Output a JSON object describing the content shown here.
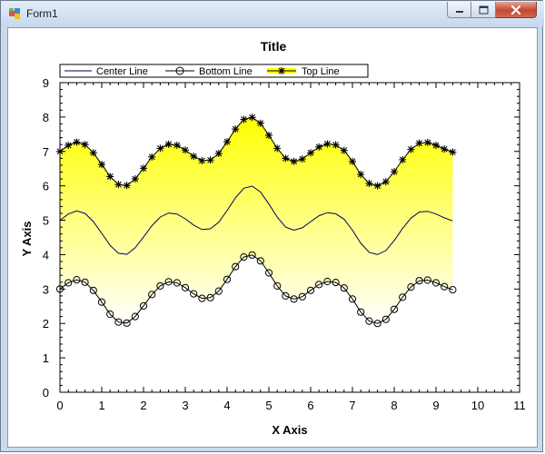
{
  "window": {
    "title": "Form1",
    "controls": {
      "minimize_icon": "minimize-icon",
      "maximize_icon": "maximize-icon",
      "close_icon": "close-icon"
    }
  },
  "colors": {
    "fill_top": "#ffff00",
    "fill_bottom": "#ffffff",
    "line": "#000066",
    "border": "#000000"
  },
  "chart_data": {
    "type": "area",
    "title": "Title",
    "xlabel": "X Axis",
    "ylabel": "Y Axis",
    "xlim": [
      0,
      11
    ],
    "ylim": [
      0,
      9
    ],
    "x_ticks": [
      "0",
      "1",
      "2",
      "3",
      "4",
      "5",
      "6",
      "7",
      "8",
      "9",
      "10",
      "11"
    ],
    "y_ticks": [
      "0",
      "1",
      "2",
      "3",
      "4",
      "5",
      "6",
      "7",
      "8",
      "9"
    ],
    "grid": false,
    "legend_position": "top",
    "legend": [
      "Center Line",
      "Bottom Line",
      "Top Line"
    ],
    "x": [
      0.0,
      0.2,
      0.4,
      0.6,
      0.8,
      1.0,
      1.2,
      1.4,
      1.6,
      1.8,
      2.0,
      2.2,
      2.4,
      2.6,
      2.8,
      3.0,
      3.2,
      3.4,
      3.6,
      3.8,
      4.0,
      4.2,
      4.4,
      4.6,
      4.8,
      5.0,
      5.2,
      5.4,
      5.6,
      5.8,
      6.0,
      6.2,
      6.4,
      6.6,
      6.8,
      7.0,
      7.2,
      7.4,
      7.6,
      7.8,
      8.0,
      8.2,
      8.4,
      8.6,
      8.8,
      9.0,
      9.2,
      9.4
    ],
    "series": [
      {
        "name": "Center Line",
        "marker": "none",
        "values": [
          5.0,
          5.18,
          5.27,
          5.2,
          4.96,
          4.62,
          4.27,
          4.04,
          4.01,
          4.2,
          4.51,
          4.84,
          5.09,
          5.21,
          5.18,
          5.04,
          4.86,
          4.73,
          4.75,
          4.94,
          5.28,
          5.65,
          5.93,
          5.99,
          5.82,
          5.47,
          5.09,
          4.8,
          4.71,
          4.78,
          4.96,
          5.13,
          5.22,
          5.19,
          5.03,
          4.71,
          4.33,
          4.07,
          4.0,
          4.12,
          4.41,
          4.76,
          5.06,
          5.24,
          5.26,
          5.18,
          5.07,
          4.98
        ]
      },
      {
        "name": "Bottom Line",
        "marker": "circle",
        "values": [
          3.0,
          3.18,
          3.27,
          3.2,
          2.96,
          2.62,
          2.27,
          2.04,
          2.01,
          2.2,
          2.51,
          2.84,
          3.09,
          3.21,
          3.18,
          3.04,
          2.86,
          2.73,
          2.75,
          2.94,
          3.28,
          3.65,
          3.93,
          3.99,
          3.82,
          3.47,
          3.09,
          2.8,
          2.71,
          2.78,
          2.96,
          3.13,
          3.22,
          3.19,
          3.03,
          2.71,
          2.33,
          2.07,
          2.0,
          2.12,
          2.41,
          2.76,
          3.06,
          3.24,
          3.26,
          3.18,
          3.07,
          2.98
        ]
      },
      {
        "name": "Top Line",
        "marker": "star",
        "values": [
          7.0,
          7.18,
          7.27,
          7.2,
          6.96,
          6.62,
          6.27,
          6.04,
          6.01,
          6.2,
          6.51,
          6.84,
          7.09,
          7.21,
          7.18,
          7.04,
          6.86,
          6.73,
          6.75,
          6.94,
          7.28,
          7.65,
          7.93,
          7.99,
          7.82,
          7.47,
          7.09,
          6.8,
          6.71,
          6.78,
          6.96,
          7.13,
          7.22,
          7.19,
          7.03,
          6.71,
          6.33,
          6.07,
          6.0,
          6.12,
          6.41,
          6.76,
          7.06,
          7.24,
          7.26,
          7.18,
          7.07,
          6.98
        ]
      }
    ]
  }
}
